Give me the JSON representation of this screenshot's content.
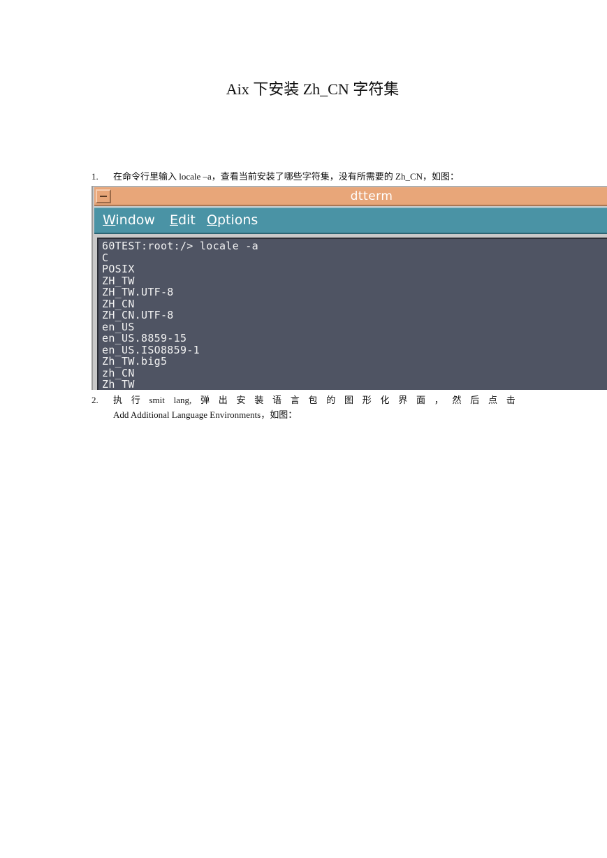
{
  "document": {
    "title": "Aix 下安装 Zh_CN 字符集",
    "steps": [
      {
        "number": "1.",
        "text": "在命令行里输入 locale –a，查看当前安装了哪些字符集，没有所需要的 Zh_CN，如图："
      },
      {
        "number": "2.",
        "line1_words": [
          "执",
          "行",
          "smit",
          "lang,",
          "弹",
          "出",
          "安",
          "装",
          "语",
          "言",
          "包",
          "的",
          "图",
          "形",
          "化",
          "界",
          "面",
          "，",
          "然",
          "后",
          "点",
          "击"
        ],
        "line2": "Add Additional Language Environments，如图："
      }
    ]
  },
  "terminal": {
    "window_title": "dtterm",
    "menu": [
      {
        "mnemonic": "W",
        "rest": "indow"
      },
      {
        "mnemonic": "E",
        "rest": "dit"
      },
      {
        "mnemonic": "O",
        "rest": "ptions"
      }
    ],
    "lines": [
      "60TEST:root:/> locale -a",
      "C",
      "POSIX",
      "ZH_TW",
      "ZH_TW.UTF-8",
      "ZH_CN",
      "ZH_CN.UTF-8",
      "en_US",
      "en_US.8859-15",
      "en_US.ISO8859-1",
      "Zh_TW.big5",
      "zh_CN",
      "Zh_TW"
    ],
    "colors": {
      "titlebar": "#e8a679",
      "menubar": "#4a93a5",
      "screen_background": "#4f5463",
      "screen_text": "#f2f2f2"
    }
  }
}
